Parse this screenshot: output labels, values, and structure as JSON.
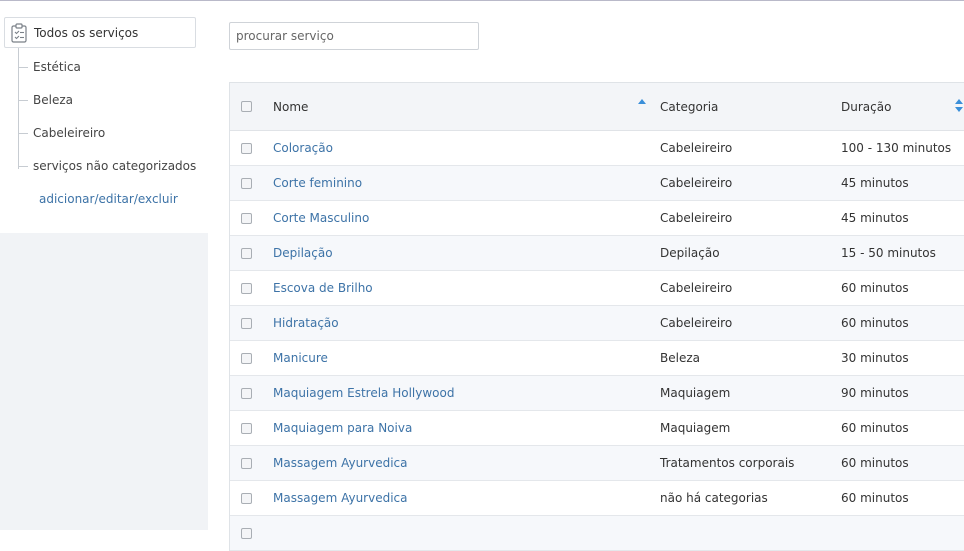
{
  "sidebar": {
    "all_label": "Todos os serviços",
    "categories": [
      {
        "label": "Estética"
      },
      {
        "label": "Beleza"
      },
      {
        "label": "Cabeleireiro"
      },
      {
        "label": "serviços não categorizados"
      }
    ],
    "edit_link": "adicionar/editar/excluir",
    "all_icon": "clipboard-icon"
  },
  "search": {
    "placeholder": "procurar serviço",
    "value": ""
  },
  "table": {
    "headers": {
      "name": "Nome",
      "category": "Categoria",
      "duration": "Duração"
    },
    "sort": {
      "name": "ascending",
      "duration": "sortable"
    },
    "rows": [
      {
        "name": "Coloração",
        "category": "Cabeleireiro",
        "duration": "100 - 130 minutos"
      },
      {
        "name": "Corte feminino",
        "category": "Cabeleireiro",
        "duration": "45 minutos"
      },
      {
        "name": "Corte Masculino",
        "category": "Cabeleireiro",
        "duration": "45 minutos"
      },
      {
        "name": "Depilação",
        "category": "Depilação",
        "duration": "15 - 50 minutos"
      },
      {
        "name": "Escova de Brilho",
        "category": "Cabeleireiro",
        "duration": "60 minutos"
      },
      {
        "name": "Hidratação",
        "category": "Cabeleireiro",
        "duration": "60 minutos"
      },
      {
        "name": "Manicure",
        "category": "Beleza",
        "duration": "30 minutos"
      },
      {
        "name": "Maquiagem Estrela Hollywood",
        "category": "Maquiagem",
        "duration": "90 minutos"
      },
      {
        "name": "Maquiagem para Noiva",
        "category": "Maquiagem",
        "duration": "60 minutos"
      },
      {
        "name": "Massagem Ayurvedica",
        "category": "Tratamentos corporais",
        "duration": "60 minutos"
      },
      {
        "name": "Massagem Ayurvedica",
        "category": "não há categorias",
        "duration": "60 minutos"
      }
    ]
  },
  "colors": {
    "link": "#3d73a7",
    "sort_arrow": "#3a8fd9",
    "sidebar_bg": "#f1f3f6",
    "header_bg": "#f3f5f8",
    "row_alt_bg": "#f6f8fb"
  }
}
